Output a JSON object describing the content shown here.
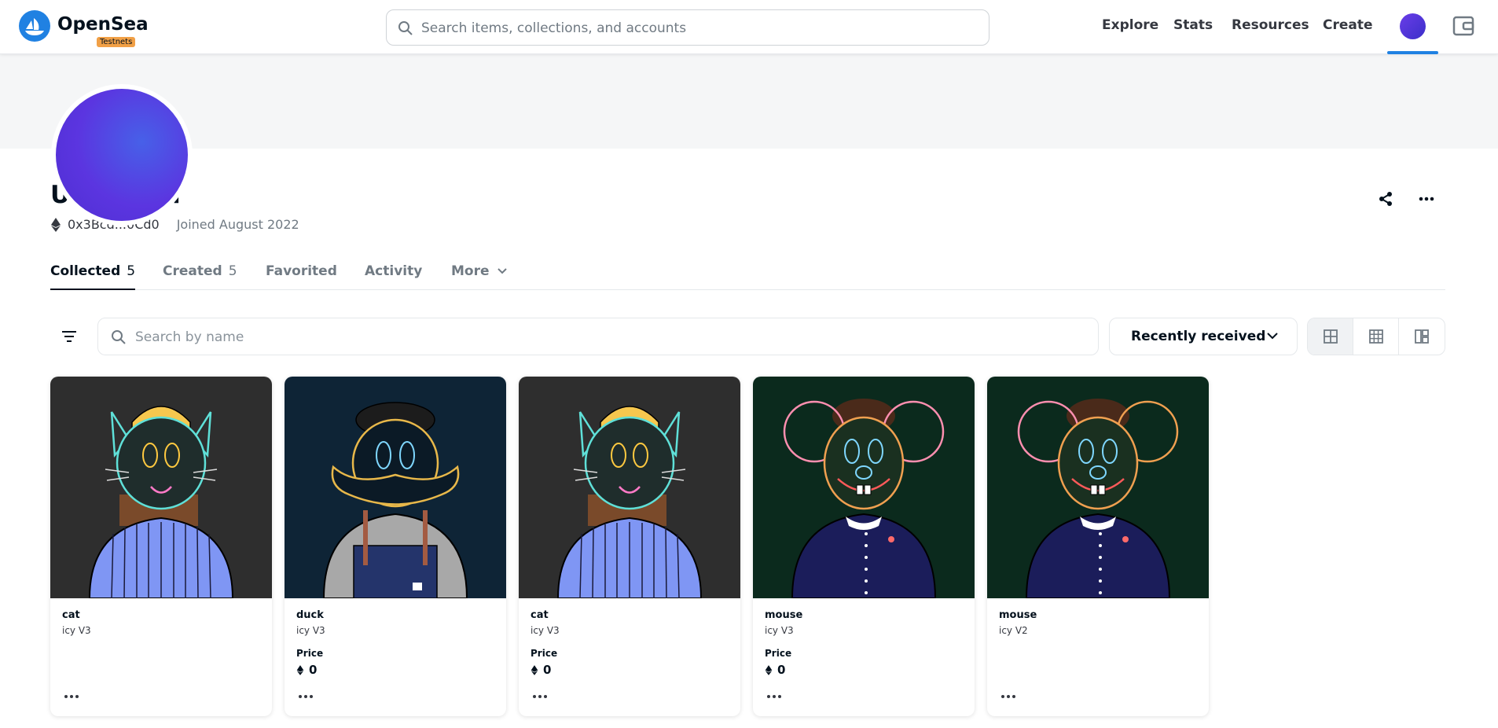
{
  "navbar": {
    "brand": "OpenSea",
    "badge": "Testnets",
    "search_placeholder": "Search items, collections, and accounts",
    "links": [
      "Explore",
      "Stats",
      "Resources",
      "Create"
    ]
  },
  "profile": {
    "name": "Unnamed",
    "address": "0x3Bcd...0Cd0",
    "joined": "Joined August 2022"
  },
  "tabs": [
    {
      "label": "Collected",
      "count": "5"
    },
    {
      "label": "Created",
      "count": "5"
    },
    {
      "label": "Favorited",
      "count": ""
    },
    {
      "label": "Activity",
      "count": ""
    },
    {
      "label": "More",
      "count": ""
    }
  ],
  "filters": {
    "search_placeholder": "Search by name",
    "sort_label": "Recently received"
  },
  "items": [
    {
      "title": "cat",
      "collection": "icy V3",
      "price_label": "",
      "price": "",
      "art": "cat"
    },
    {
      "title": "duck",
      "collection": "icy V3",
      "price_label": "Price",
      "price": "0",
      "art": "duck"
    },
    {
      "title": "cat",
      "collection": "icy V3",
      "price_label": "Price",
      "price": "0",
      "art": "cat"
    },
    {
      "title": "mouse",
      "collection": "icy V3",
      "price_label": "Price",
      "price": "0",
      "art": "mouse"
    },
    {
      "title": "mouse",
      "collection": "icy V2",
      "price_label": "",
      "price": "",
      "art": "mouse"
    }
  ],
  "colors": {
    "accent": "#2081e2",
    "cat_bg": "#2e2e2e",
    "duck_bg": "#0e2436",
    "mouse_bg": "#0b2a1d"
  }
}
